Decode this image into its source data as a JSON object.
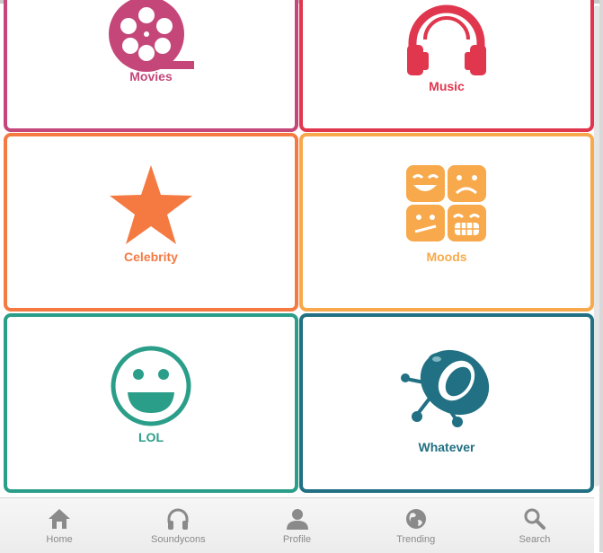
{
  "tiles": [
    {
      "label": "Movies",
      "color": "#c5477a",
      "icon": "film-reel-icon"
    },
    {
      "label": "Music",
      "color": "#e0364e",
      "icon": "headphones-icon"
    },
    {
      "label": "Celebrity",
      "color": "#f47a42",
      "icon": "star-icon"
    },
    {
      "label": "Moods",
      "color": "#f7a94b",
      "icon": "emoji-faces-icon"
    },
    {
      "label": "LOL",
      "color": "#2b9e8a",
      "icon": "smiley-face-icon"
    },
    {
      "label": "Whatever",
      "color": "#217083",
      "icon": "ufo-icon"
    }
  ],
  "nav": [
    {
      "label": "Home",
      "icon": "home-icon"
    },
    {
      "label": "Soundycons",
      "icon": "headphones-icon"
    },
    {
      "label": "Profile",
      "icon": "user-icon"
    },
    {
      "label": "Trending",
      "icon": "globe-icon"
    },
    {
      "label": "Search",
      "icon": "search-icon"
    }
  ],
  "nav_color": "#8a8a8a"
}
